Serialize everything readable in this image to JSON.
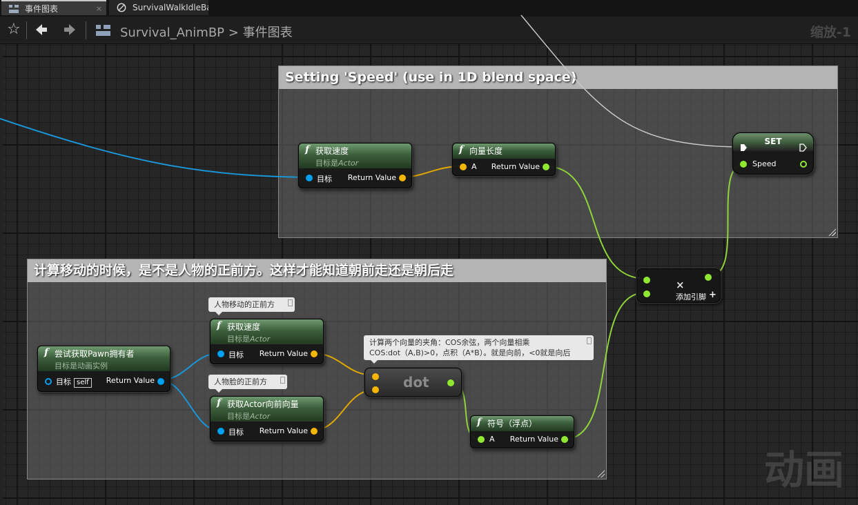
{
  "tabs": [
    {
      "label": "事件图表",
      "close": "×"
    },
    {
      "label": "SurvivalWalkIdleBa"
    }
  ],
  "toolbar": {
    "favorite_icon": "☆",
    "back_icon": "🡄",
    "forward_icon": "🡆",
    "breadcrumb_root": "Survival_AnimBP",
    "breadcrumb_sep": ">",
    "breadcrumb_current": "事件图表",
    "zoom": "缩放-1"
  },
  "comments": {
    "speed_title": "Setting 'Speed' (use in 1D blend space)",
    "direction_title": "计算移动的时候，是不是人物的正前方。这样才能知道朝前走还是朝后走"
  },
  "nodes": {
    "get_velocity_1": {
      "title": "获取速度",
      "target_prefix": "目标是",
      "target": "Actor",
      "pin_in": "目标",
      "pin_out": "Return Value"
    },
    "vector_length": {
      "title": "向量长度",
      "pin_in": "A",
      "pin_out": "Return Value"
    },
    "set_speed": {
      "title": "SET",
      "pin": "Speed"
    },
    "multiply": {
      "symbol": "×",
      "add_pin": "添加引脚",
      "add_icon": "+"
    },
    "try_get_pawn": {
      "title": "尝试获取Pawn拥有者",
      "subtitle": "目标是动画实例",
      "pin_in": "目标",
      "self": "self",
      "pin_out": "Return Value"
    },
    "get_velocity_2": {
      "title": "获取速度",
      "target_prefix": "目标是",
      "target": "Actor",
      "pin_in": "目标",
      "pin_out": "Return Value"
    },
    "get_forward": {
      "title": "获取Actor向前向量",
      "target_prefix": "目标是",
      "target": "Actor",
      "pin_in": "目标",
      "pin_out": "Return Value"
    },
    "dot": {
      "title": "dot"
    },
    "sign": {
      "title": "符号（浮点）",
      "pin_in": "A",
      "pin_out": "Return Value"
    }
  },
  "notes": {
    "move_forward": "人物移动的正前方",
    "face_forward": "人物脸的正前方",
    "dot_line1": "计算两个向量的夹角：COS余弦，两个向量相乘",
    "dot_line2": "COS:dot（A,B)>0，点积（A*B）。就是向前，<0就是向后"
  },
  "watermark": "动画",
  "colors": {
    "object_pin": "#00a0f0",
    "vector_pin": "#f7b600",
    "float_pin": "#90e830",
    "function_header": "#3c5f3c",
    "exec_wire": "#c8c8c8"
  }
}
